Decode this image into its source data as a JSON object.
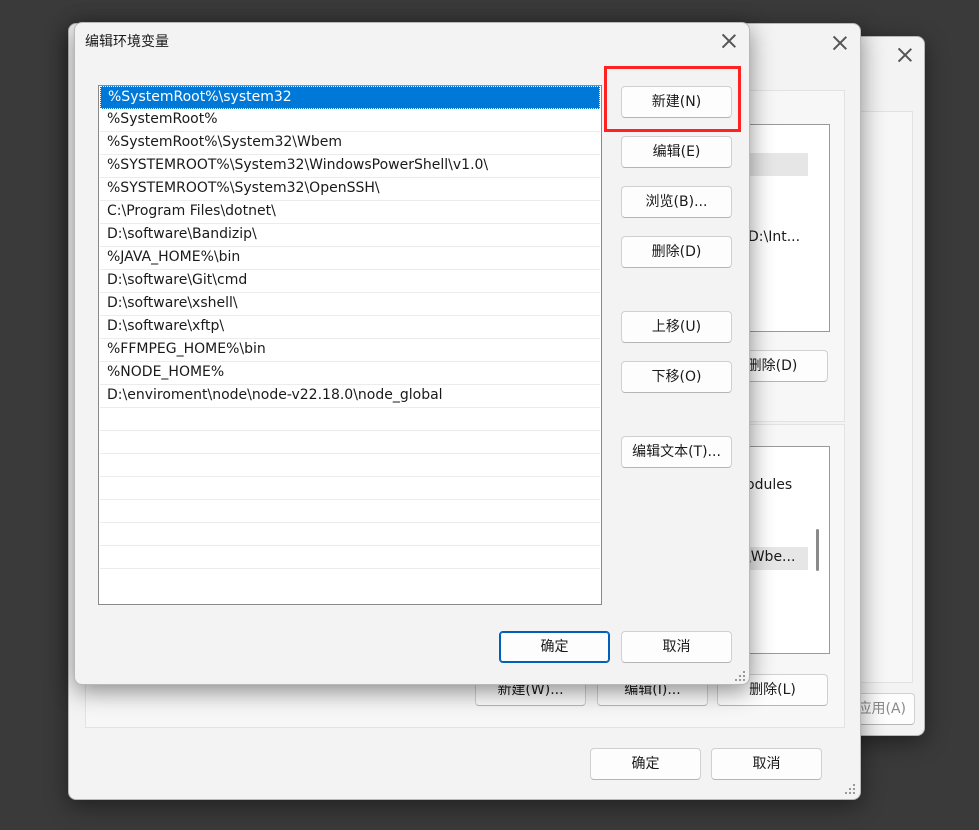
{
  "back_window": {
    "apply_label": "应用(A)"
  },
  "middle_window": {
    "user_var_delete": "删除(D)",
    "user_list_text": "D:\\Int...",
    "sys_list_text_1": "odules",
    "sys_list_text_2": "\\Wbe...",
    "sys_new": "新建(W)...",
    "sys_edit": "编辑(I)...",
    "sys_delete": "删除(L)",
    "ok": "确定",
    "cancel": "取消"
  },
  "dialog": {
    "title": "编辑环境变量",
    "paths": [
      "%SystemRoot%\\system32",
      "%SystemRoot%",
      "%SystemRoot%\\System32\\Wbem",
      "%SYSTEMROOT%\\System32\\WindowsPowerShell\\v1.0\\",
      "%SYSTEMROOT%\\System32\\OpenSSH\\",
      "C:\\Program Files\\dotnet\\",
      "D:\\software\\Bandizip\\",
      "%JAVA_HOME%\\bin",
      "D:\\software\\Git\\cmd",
      "D:\\software\\xshell\\",
      "D:\\software\\xftp\\",
      "%FFMPEG_HOME%\\bin",
      "%NODE_HOME%",
      "D:\\enviroment\\node\\node-v22.18.0\\node_global"
    ],
    "buttons": {
      "new": "新建(N)",
      "edit": "编辑(E)",
      "browse": "浏览(B)...",
      "delete": "删除(D)",
      "move_up": "上移(U)",
      "move_down": "下移(O)",
      "edit_text": "编辑文本(T)...",
      "ok": "确定",
      "cancel": "取消"
    }
  },
  "colors": {
    "selection": "#0078d7",
    "highlight": "#ff2222",
    "primary_border": "#005fb8"
  }
}
